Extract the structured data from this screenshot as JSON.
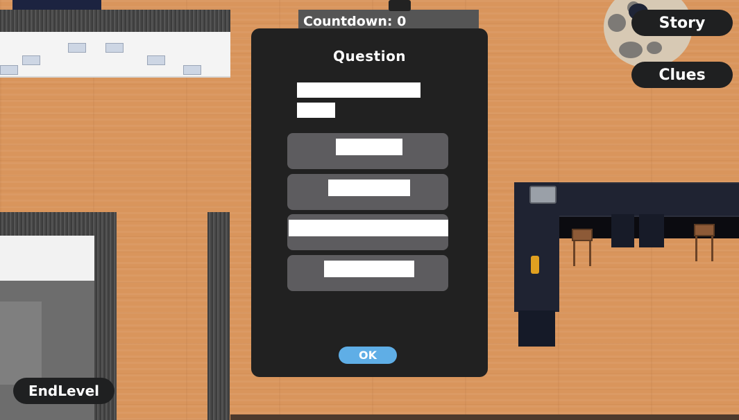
{
  "hud": {
    "countdown_label": "Countdown:",
    "countdown_value": "0",
    "story_button": "Story",
    "clues_button": "Clues",
    "end_level_button": "EndLevel"
  },
  "question_dialog": {
    "title": "Question",
    "ok_button": "OK"
  },
  "colors": {
    "dialog_bg": "#212121",
    "answer_bg": "#5d5c5f",
    "ok_button": "#5faee6",
    "hud_button_bg": "#1f2021",
    "floor": "#d9955c"
  }
}
